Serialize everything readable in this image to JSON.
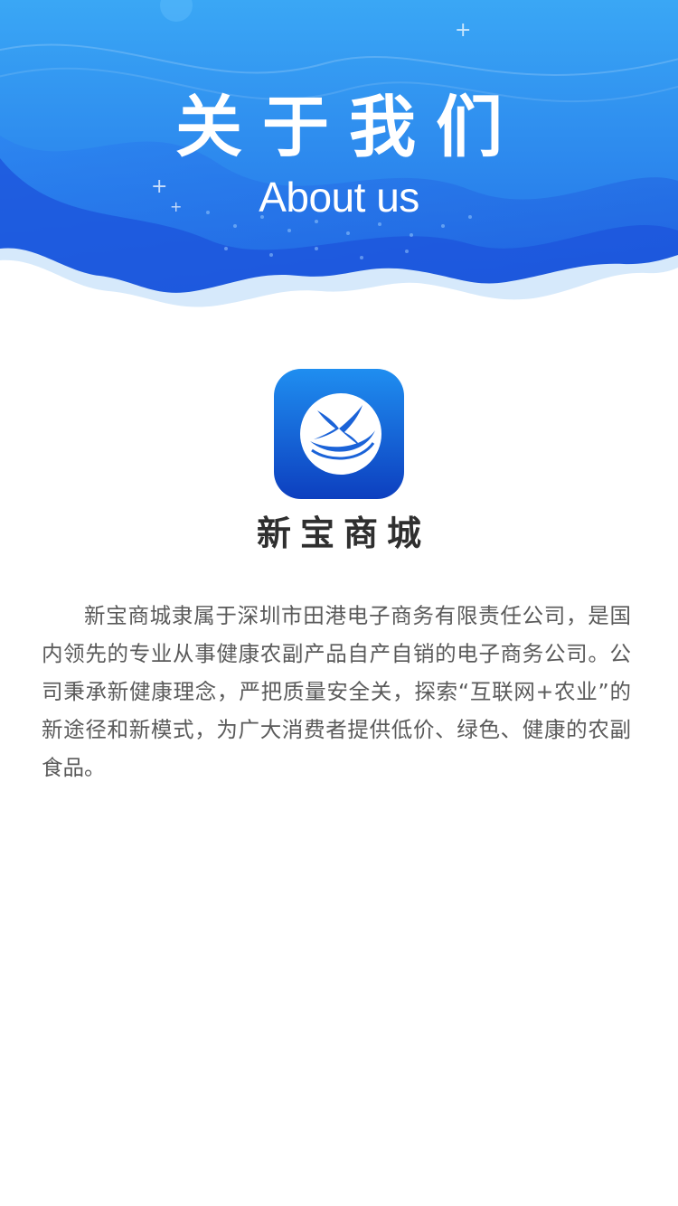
{
  "header": {
    "title": "关于我们",
    "subtitle": "About us",
    "colors": {
      "top": "#3aa7f5",
      "bottom": "#1f5fdf",
      "wave_light": "#d6e9fb"
    }
  },
  "app": {
    "name": "新宝商城",
    "logo_icon": "xinbao-mall-logo-icon",
    "logo_colors": {
      "top": "#1f8ef0",
      "bottom": "#0d3fbf"
    }
  },
  "intro": {
    "text": "新宝商城隶属于深圳市田港电子商务有限责任公司，是国内领先的专业从事健康农副产品自产自销的电子商务公司。公司秉承新健康理念，严把质量安全关，探索“互联网+农业”的新途径和新模式，为广大消费者提供低价、绿色、健康的农副食品。"
  }
}
